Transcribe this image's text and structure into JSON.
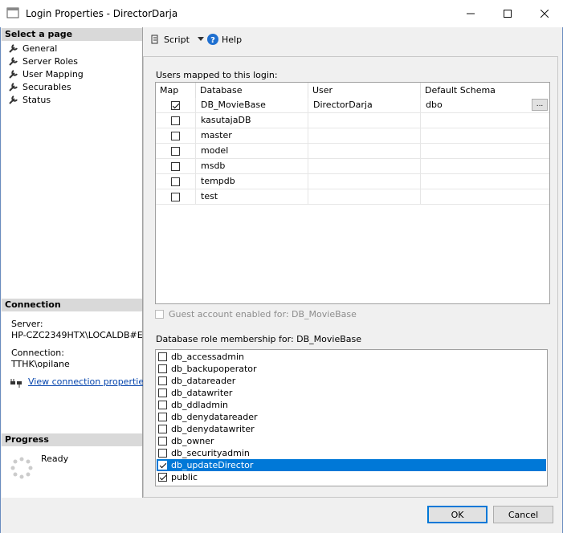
{
  "window": {
    "title": "Login Properties - DirectorDarja"
  },
  "left": {
    "select_page_header": "Select a page",
    "pages": [
      "General",
      "Server Roles",
      "User Mapping",
      "Securables",
      "Status"
    ],
    "connection_header": "Connection",
    "server_label": "Server:",
    "server_value": "HP-CZC2349HTX\\LOCALDB#E24",
    "connection_label": "Connection:",
    "connection_value": "TTHK\\opilane",
    "view_conn_link": "View connection properties",
    "progress_header": "Progress",
    "progress_status": "Ready"
  },
  "toolbar": {
    "script_label": "Script",
    "help_label": "Help"
  },
  "main": {
    "users_mapped_label": "Users mapped to this login:",
    "columns": [
      "Map",
      "Database",
      "User",
      "Default Schema"
    ],
    "rows": [
      {
        "map": true,
        "database": "DB_MovieBase",
        "user": "DirectorDarja",
        "schema": "dbo"
      },
      {
        "map": false,
        "database": "kasutajaDB",
        "user": "",
        "schema": ""
      },
      {
        "map": false,
        "database": "master",
        "user": "",
        "schema": ""
      },
      {
        "map": false,
        "database": "model",
        "user": "",
        "schema": ""
      },
      {
        "map": false,
        "database": "msdb",
        "user": "",
        "schema": ""
      },
      {
        "map": false,
        "database": "tempdb",
        "user": "",
        "schema": ""
      },
      {
        "map": false,
        "database": "test",
        "user": "",
        "schema": ""
      }
    ],
    "ellipsis": "...",
    "guest_label": "Guest account enabled for: DB_MovieBase",
    "role_label": "Database role membership for: DB_MovieBase",
    "roles": [
      {
        "name": "db_accessadmin",
        "checked": false
      },
      {
        "name": "db_backupoperator",
        "checked": false
      },
      {
        "name": "db_datareader",
        "checked": false
      },
      {
        "name": "db_datawriter",
        "checked": false
      },
      {
        "name": "db_ddladmin",
        "checked": false
      },
      {
        "name": "db_denydatareader",
        "checked": false
      },
      {
        "name": "db_denydatawriter",
        "checked": false
      },
      {
        "name": "db_owner",
        "checked": false
      },
      {
        "name": "db_securityadmin",
        "checked": false
      },
      {
        "name": "db_updateDirector",
        "checked": true,
        "selected": true
      },
      {
        "name": "public",
        "checked": true
      }
    ]
  },
  "buttons": {
    "ok": "OK",
    "cancel": "Cancel"
  },
  "colors": {
    "selection": "#0078d7",
    "link": "#0645ad"
  }
}
